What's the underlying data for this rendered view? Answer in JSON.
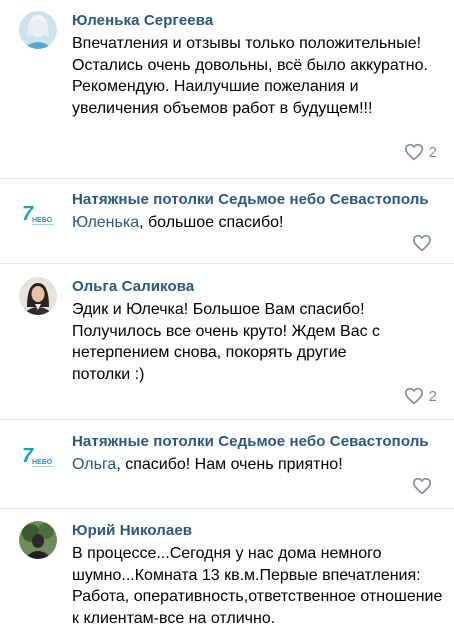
{
  "comments": [
    {
      "author": "Юленька Сергеева",
      "text": "Впечатления и отзывы только положительные! Остались очень довольны, всё было аккуратно. Рекомендую. Наилучшие пожелания и увеличения объемов работ в будущем!!!",
      "likes": "2"
    },
    {
      "author": "Натяжные потолки Седьмое небо Севастополь",
      "mention": "Юленька",
      "text": ", большое спасибо!",
      "likes": ""
    },
    {
      "author": "Ольга Саликова",
      "text": "Эдик и Юлечка! Большое Вам спасибо! Получилось все очень круто! Ждем Вас с нетерпением снова, покорять другие потолки :)",
      "likes": "2"
    },
    {
      "author": "Натяжные потолки Седьмое небо Севастополь",
      "mention": "Ольга",
      "text": ", спасибо! Нам очень приятно!",
      "likes": ""
    },
    {
      "author": "Юрий Николаев",
      "text": "В процессе...Сегодня у нас дома немного шумно...Комната 13 кв.м.Первые впечатления: Работа, оперативность,ответственное отношение к клиентам-все на отлично.",
      "likes": ""
    }
  ],
  "brand_logo": {
    "number": "7",
    "word": "НЕБО"
  },
  "colors": {
    "link": "#2a5885",
    "muted": "#818c99",
    "divider": "#e7e8ec",
    "brand_teal": "#1aa3b8"
  },
  "icons": {
    "like": "heart-outline-icon"
  }
}
